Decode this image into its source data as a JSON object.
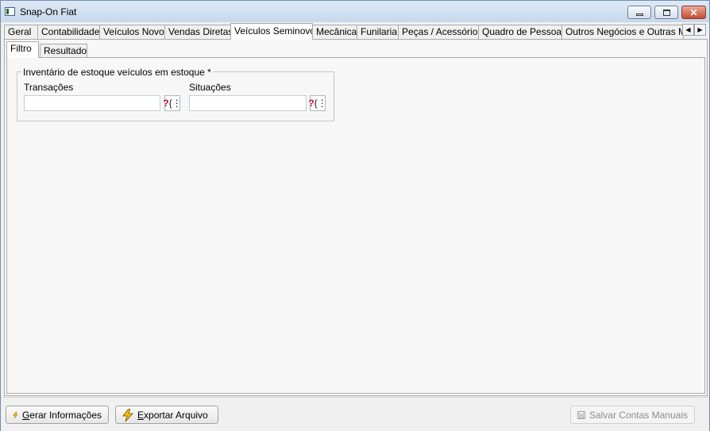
{
  "window": {
    "title": "Snap-On Fiat"
  },
  "tabs": [
    {
      "label": "Geral"
    },
    {
      "label": "Contabilidade"
    },
    {
      "label": "Veículos Novos"
    },
    {
      "label": "Vendas Diretas"
    },
    {
      "label": "Veículos Seminovos"
    },
    {
      "label": "Mecânica"
    },
    {
      "label": "Funilaria"
    },
    {
      "label": "Peças / Acessórios"
    },
    {
      "label": "Quadro de Pessoas"
    },
    {
      "label": "Outros Negócios e Outras Man"
    }
  ],
  "active_tab": "Veículos Seminovos",
  "subtabs": [
    {
      "label": "Filtro"
    },
    {
      "label": "Resultado"
    }
  ],
  "active_subtab": "Filtro",
  "filter": {
    "group_title": "Inventário de estoque veículos em estoque *",
    "transacoes_label": "Transações",
    "transacoes_value": "",
    "situacoes_label": "Situações",
    "situacoes_value": ""
  },
  "buttons": {
    "gerar": {
      "underline": "G",
      "rest": "erar Informações"
    },
    "exportar": {
      "underline": "E",
      "rest": "xportar Arquivo"
    },
    "salvar": "Salvar Contas Manuais"
  },
  "icons": {
    "action": "lightning-icon",
    "save": "save-disk-icon",
    "lookup": "lookup-help-icon"
  },
  "colors": {
    "titlebar": "#c7d8ec",
    "lightning": "#f2c200",
    "lookup_question": "#c8102e"
  }
}
